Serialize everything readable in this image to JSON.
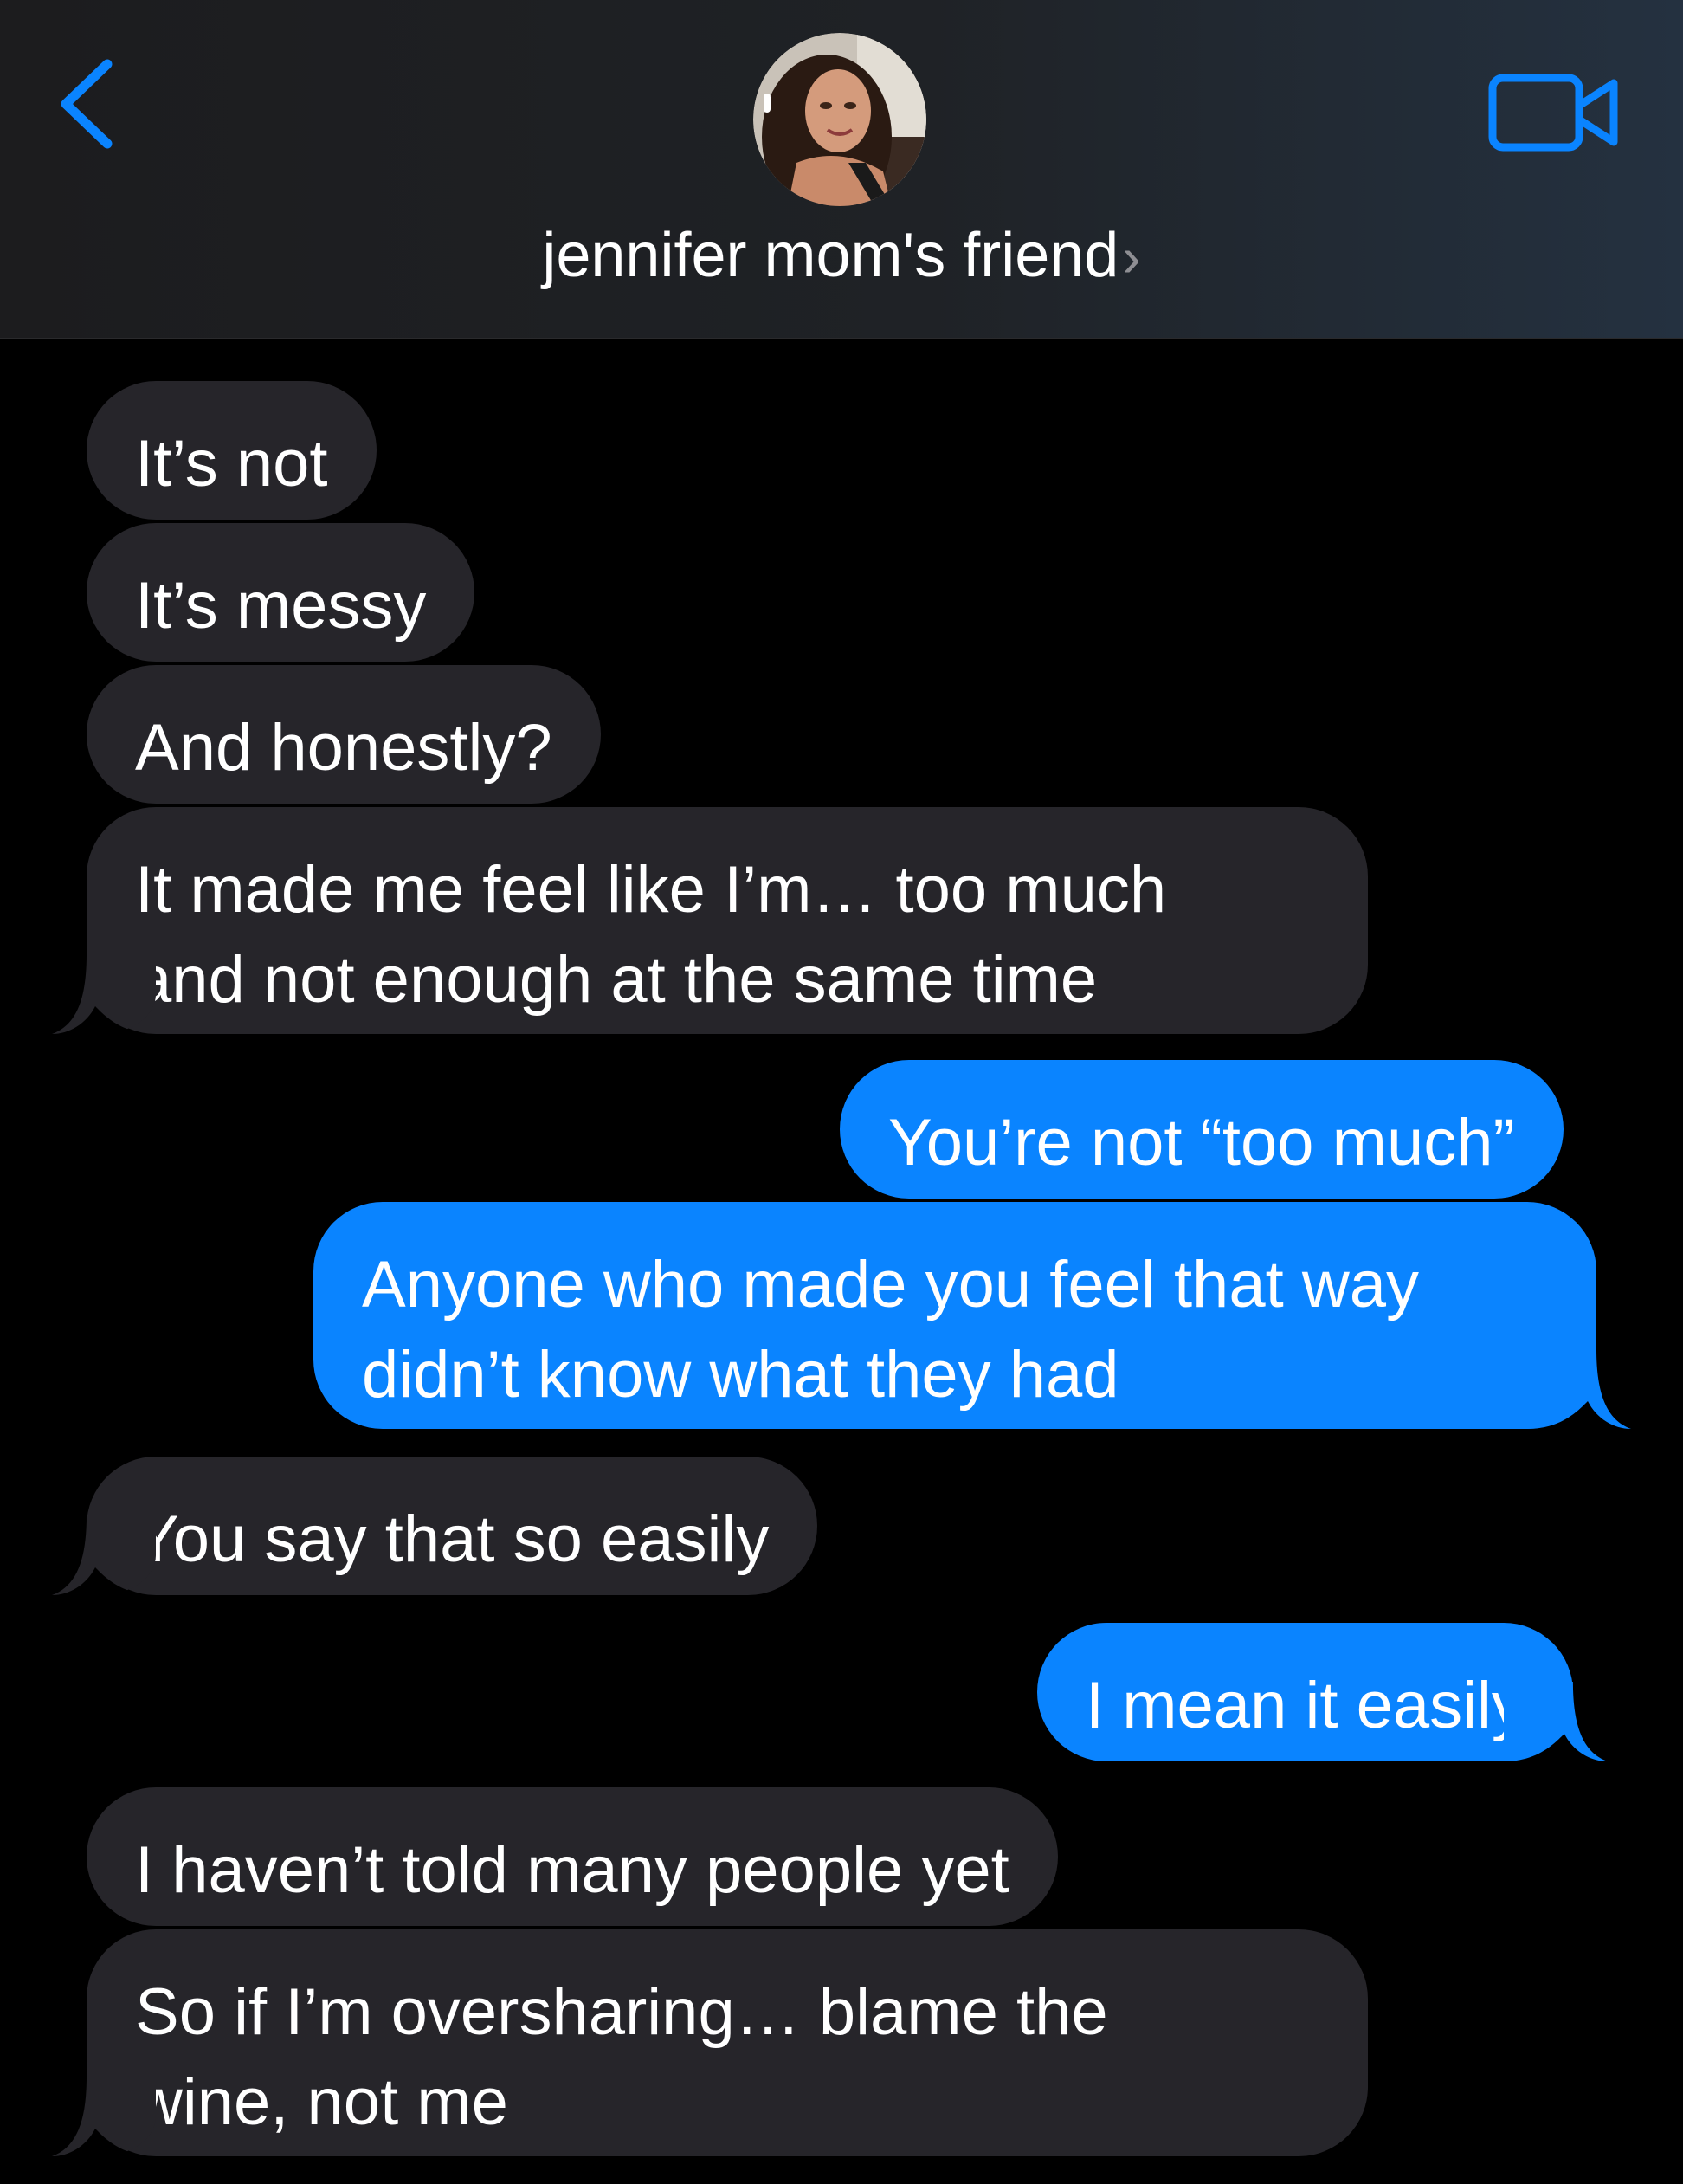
{
  "header": {
    "contact_name": "jennifer mom's friend",
    "chevron": "›",
    "back_icon": "chevron-left-icon",
    "video_icon": "video-camera-icon",
    "accent_color": "#0a84ff"
  },
  "messages": [
    {
      "direction": "incoming",
      "text": "It’s not"
    },
    {
      "direction": "incoming",
      "text": "It’s messy"
    },
    {
      "direction": "incoming",
      "text": "And honestly?"
    },
    {
      "direction": "incoming",
      "lines": [
        "It made me feel like I’m… too much",
        "and not enough at the same time"
      ]
    },
    {
      "direction": "outgoing",
      "text": "You’re not “too much”"
    },
    {
      "direction": "outgoing",
      "lines": [
        "Anyone who made you feel that way",
        "didn’t know what they had"
      ]
    },
    {
      "direction": "incoming",
      "text": "You say that so easily"
    },
    {
      "direction": "outgoing",
      "text": "I mean it easily"
    },
    {
      "direction": "incoming",
      "text": "I haven’t told many people yet"
    },
    {
      "direction": "incoming",
      "lines": [
        "So if I’m oversharing… blame the",
        "wine, not me"
      ]
    }
  ],
  "colors": {
    "incoming_bubble": "#26252a",
    "outgoing_bubble": "#0a84ff",
    "background": "#000000"
  }
}
